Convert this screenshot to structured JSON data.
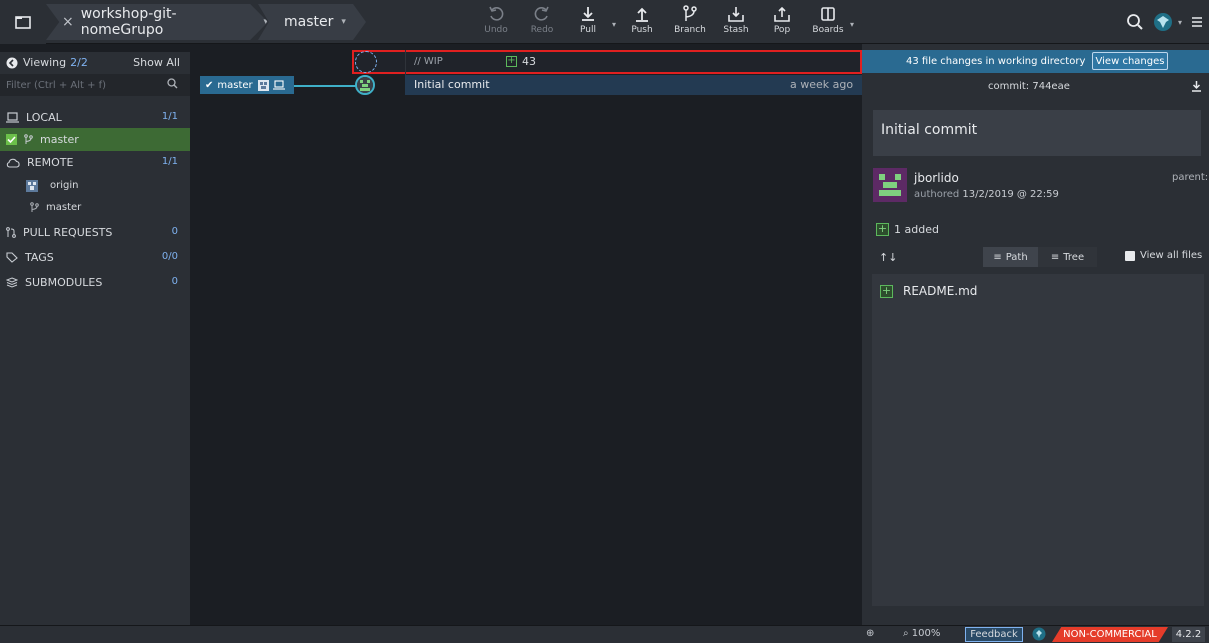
{
  "toolbar": {
    "repo_name": "workshop-git-nomeGrupo",
    "branch_name": "master",
    "tools": {
      "undo": "Undo",
      "redo": "Redo",
      "pull": "Pull",
      "push": "Push",
      "branch": "Branch",
      "stash": "Stash",
      "pop": "Pop",
      "boards": "Boards"
    }
  },
  "left_panel": {
    "viewing_label": "Viewing",
    "viewing_count": "2/2",
    "show_all": "Show All",
    "filter_placeholder": "Filter (Ctrl + Alt + f)",
    "local": {
      "label": "LOCAL",
      "count": "1/1"
    },
    "local_branch": "master",
    "remote": {
      "label": "REMOTE",
      "count": "1/1"
    },
    "remote_origin": "origin",
    "remote_branch": "master",
    "pull_requests": {
      "label": "PULL REQUESTS",
      "count": "0"
    },
    "tags": {
      "label": "TAGS",
      "count": "0/0"
    },
    "submodules": {
      "label": "SUBMODULES",
      "count": "0"
    }
  },
  "graph": {
    "wip_label": "// WIP",
    "wip_count": "43",
    "branch_label": "master",
    "commit_message": "Initial commit",
    "commit_time": "a week ago"
  },
  "right_panel": {
    "changes_text": "43 file changes in working directory",
    "view_changes": "View changes",
    "commit_hash": "commit: 744eae",
    "message": "Initial commit",
    "author": "jborlido",
    "authored_prefix": "authored",
    "authored_date": "13/2/2019 @ 22:59",
    "parent_label": "parent:",
    "added_text": "1 added",
    "path_label": "Path",
    "tree_label": "Tree",
    "view_all_files": "View all files",
    "file_name": "README.md"
  },
  "status_bar": {
    "zoom": "100%",
    "feedback": "Feedback",
    "license": "NON-COMMERCIAL",
    "version": "4.2.2"
  },
  "colors": {
    "toolbar_bg": "#2b2f35",
    "accent_blue": "#2a6a91",
    "branch_teal": "#3fb0c8",
    "selected_green": "#3d6a34",
    "highlight_red": "#e02020",
    "license_red": "#e53c2a"
  }
}
